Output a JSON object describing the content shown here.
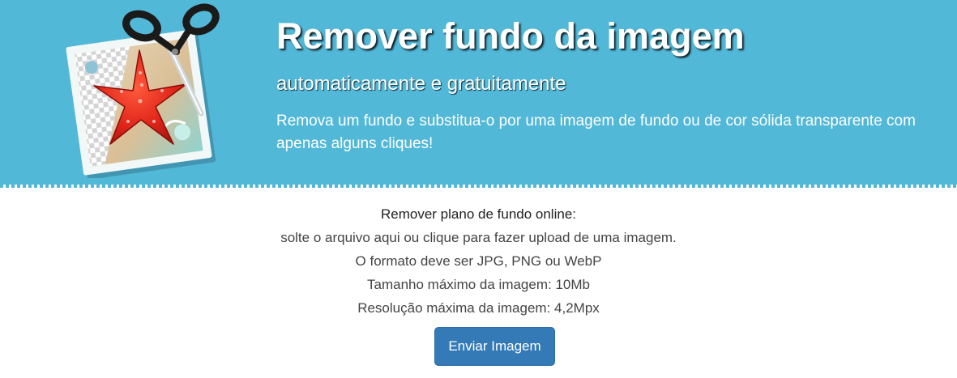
{
  "hero": {
    "title": "Remover fundo da imagem",
    "subtitle": "automaticamente e gratuitamente",
    "description": "Remova um fundo e substitua-o por uma imagem de fundo ou de cor sólida transparente com apenas alguns cliques!",
    "logo_icon": "photo-scissors-starfish-icon",
    "background_color": "#52b8d8"
  },
  "upload": {
    "heading": "Remover plano de fundo online:",
    "instruction": "solte o arquivo aqui ou clique para fazer upload de uma imagem.",
    "format": "O formato deve ser JPG, PNG ou WebP",
    "max_size": "Tamanho máximo da imagem: 10Mb",
    "max_resolution": "Resolução máxima da imagem: 4,2Mpx",
    "button_label": "Enviar Imagem",
    "button_color": "#337ab7"
  }
}
